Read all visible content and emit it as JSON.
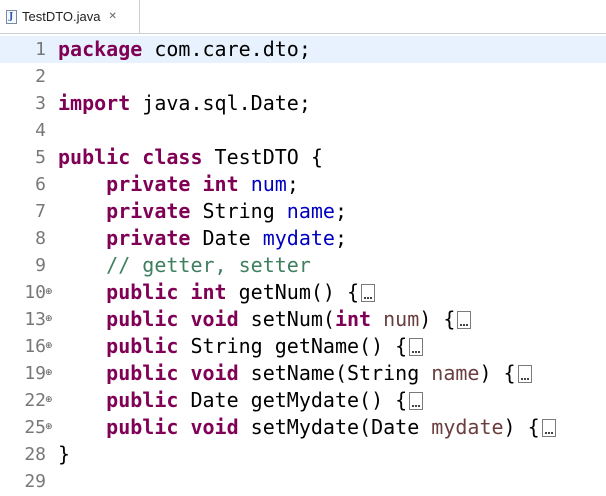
{
  "tab": {
    "title": "TestDTO.java",
    "close_glyph": "✕"
  },
  "lines": [
    {
      "n": "1",
      "fold": "",
      "current": true,
      "tokens": [
        {
          "t": "package",
          "c": "kw"
        },
        {
          "t": " com.care.dto;",
          "c": ""
        }
      ]
    },
    {
      "n": "2",
      "fold": "",
      "tokens": []
    },
    {
      "n": "3",
      "fold": "",
      "tokens": [
        {
          "t": "import",
          "c": "kw"
        },
        {
          "t": " java.sql.Date;",
          "c": ""
        }
      ]
    },
    {
      "n": "4",
      "fold": "",
      "tokens": []
    },
    {
      "n": "5",
      "fold": "",
      "tokens": [
        {
          "t": "public",
          "c": "kw"
        },
        {
          "t": " ",
          "c": ""
        },
        {
          "t": "class",
          "c": "kw"
        },
        {
          "t": " TestDTO {",
          "c": ""
        }
      ]
    },
    {
      "n": "6",
      "fold": "",
      "tokens": [
        {
          "t": "    ",
          "c": ""
        },
        {
          "t": "private",
          "c": "kw"
        },
        {
          "t": " ",
          "c": ""
        },
        {
          "t": "int",
          "c": "kw"
        },
        {
          "t": " ",
          "c": ""
        },
        {
          "t": "num",
          "c": "field"
        },
        {
          "t": ";",
          "c": ""
        }
      ]
    },
    {
      "n": "7",
      "fold": "",
      "tokens": [
        {
          "t": "    ",
          "c": ""
        },
        {
          "t": "private",
          "c": "kw"
        },
        {
          "t": " String ",
          "c": ""
        },
        {
          "t": "name",
          "c": "field"
        },
        {
          "t": ";",
          "c": ""
        }
      ]
    },
    {
      "n": "8",
      "fold": "",
      "tokens": [
        {
          "t": "    ",
          "c": ""
        },
        {
          "t": "private",
          "c": "kw"
        },
        {
          "t": " Date ",
          "c": ""
        },
        {
          "t": "mydate",
          "c": "field"
        },
        {
          "t": ";",
          "c": ""
        }
      ]
    },
    {
      "n": "9",
      "fold": "",
      "tokens": [
        {
          "t": "    ",
          "c": ""
        },
        {
          "t": "// getter, setter",
          "c": "comment"
        }
      ]
    },
    {
      "n": "10",
      "fold": "⊕",
      "collapsed": true,
      "tokens": [
        {
          "t": "    ",
          "c": ""
        },
        {
          "t": "public",
          "c": "kw"
        },
        {
          "t": " ",
          "c": ""
        },
        {
          "t": "int",
          "c": "kw"
        },
        {
          "t": " getNum() {",
          "c": ""
        }
      ]
    },
    {
      "n": "13",
      "fold": "⊕",
      "collapsed": true,
      "tokens": [
        {
          "t": "    ",
          "c": ""
        },
        {
          "t": "public",
          "c": "kw"
        },
        {
          "t": " ",
          "c": ""
        },
        {
          "t": "void",
          "c": "kw"
        },
        {
          "t": " setNum(",
          "c": ""
        },
        {
          "t": "int",
          "c": "kw"
        },
        {
          "t": " ",
          "c": ""
        },
        {
          "t": "num",
          "c": "param"
        },
        {
          "t": ") {",
          "c": ""
        }
      ]
    },
    {
      "n": "16",
      "fold": "⊕",
      "collapsed": true,
      "tokens": [
        {
          "t": "    ",
          "c": ""
        },
        {
          "t": "public",
          "c": "kw"
        },
        {
          "t": " String getName() {",
          "c": ""
        }
      ]
    },
    {
      "n": "19",
      "fold": "⊕",
      "collapsed": true,
      "tokens": [
        {
          "t": "    ",
          "c": ""
        },
        {
          "t": "public",
          "c": "kw"
        },
        {
          "t": " ",
          "c": ""
        },
        {
          "t": "void",
          "c": "kw"
        },
        {
          "t": " setName(String ",
          "c": ""
        },
        {
          "t": "name",
          "c": "param"
        },
        {
          "t": ") {",
          "c": ""
        }
      ]
    },
    {
      "n": "22",
      "fold": "⊕",
      "collapsed": true,
      "tokens": [
        {
          "t": "    ",
          "c": ""
        },
        {
          "t": "public",
          "c": "kw"
        },
        {
          "t": " Date getMydate() {",
          "c": ""
        }
      ]
    },
    {
      "n": "25",
      "fold": "⊕",
      "collapsed": true,
      "tokens": [
        {
          "t": "    ",
          "c": ""
        },
        {
          "t": "public",
          "c": "kw"
        },
        {
          "t": " ",
          "c": ""
        },
        {
          "t": "void",
          "c": "kw"
        },
        {
          "t": " setMydate(Date ",
          "c": ""
        },
        {
          "t": "mydate",
          "c": "param"
        },
        {
          "t": ") {",
          "c": ""
        }
      ]
    },
    {
      "n": "28",
      "fold": "",
      "tokens": [
        {
          "t": "}",
          "c": ""
        }
      ]
    },
    {
      "n": "29",
      "fold": "",
      "tokens": []
    }
  ]
}
